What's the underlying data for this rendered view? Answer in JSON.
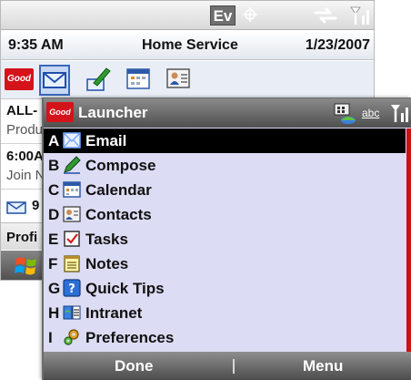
{
  "background": {
    "status_bar": {
      "ev_label": "Ev",
      "gps_icon": "gps-crosshair-icon",
      "sync_icon": "sync-arrows-icon",
      "signal_icon": "signal-strength-icon"
    },
    "title_bar": {
      "time": "9:35 AM",
      "title": "Home Service",
      "date": "1/23/2007"
    },
    "toolbar": {
      "logo_text": "Good",
      "icons": [
        "email-icon",
        "compose-icon",
        "calendar-icon",
        "contacts-icon"
      ]
    },
    "list": {
      "line1": "ALL-",
      "line2": "Produ",
      "line3": "6:00A",
      "line4": "Join N",
      "line5": "9",
      "line6": "Profi"
    }
  },
  "launcher": {
    "logo_text": "Good",
    "title": "Launcher",
    "abc_label": "abc",
    "items": [
      {
        "key": "A",
        "label": "Email",
        "icon": "email-icon",
        "selected": true
      },
      {
        "key": "B",
        "label": "Compose",
        "icon": "compose-icon",
        "selected": false
      },
      {
        "key": "C",
        "label": "Calendar",
        "icon": "calendar-icon",
        "selected": false
      },
      {
        "key": "D",
        "label": "Contacts",
        "icon": "contacts-icon",
        "selected": false
      },
      {
        "key": "E",
        "label": "Tasks",
        "icon": "tasks-icon",
        "selected": false
      },
      {
        "key": "F",
        "label": "Notes",
        "icon": "notes-icon",
        "selected": false
      },
      {
        "key": "G",
        "label": "Quick Tips",
        "icon": "quick-tips-icon",
        "selected": false
      },
      {
        "key": "H",
        "label": "Intranet",
        "icon": "intranet-icon",
        "selected": false
      },
      {
        "key": "I",
        "label": "Preferences",
        "icon": "preferences-icon",
        "selected": false
      }
    ],
    "softkeys": {
      "left": "Done",
      "right": "Menu"
    }
  },
  "colors": {
    "good_red": "#d4131b",
    "selection": "#000000",
    "menu_bg": "#dcdcf4",
    "scroll_thumb": "#cc1111"
  }
}
